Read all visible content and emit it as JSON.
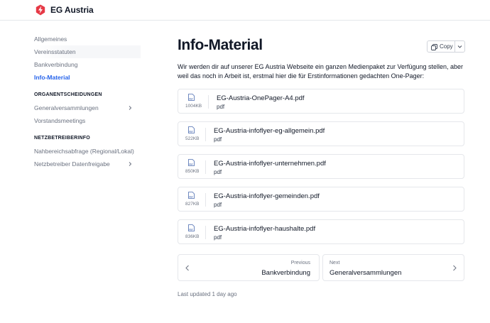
{
  "header": {
    "brand": "EG Austria",
    "logo_icon": "lightning-bolt-logo",
    "brand_color": "#e63946"
  },
  "sidebar": {
    "items": [
      {
        "label": "Allgemeines"
      },
      {
        "label": "Vereinsstatuten"
      },
      {
        "label": "Bankverbindung"
      },
      {
        "label": "Info-Material",
        "active": true
      }
    ],
    "section1": {
      "heading": "ORGANENTSCHEIDUNGEN",
      "items": [
        {
          "label": "Generalversammlungen",
          "has_children": true
        },
        {
          "label": "Vorstandsmeetings"
        }
      ]
    },
    "section2": {
      "heading": "NETZBETREIBERINFO",
      "items": [
        {
          "label": "Nahbereichsabfrage (Regional/Lokal)"
        },
        {
          "label": "Netzbetreiber Datenfreigabe",
          "has_children": true
        }
      ]
    },
    "active_color": "#2563eb"
  },
  "main": {
    "title": "Info-Material",
    "copy_label": "Copy",
    "intro": "Wir werden dir auf unserer EG Austria Webseite ein ganzen Medienpaket zur Verfügung stellen, aber weil das noch in Arbeit ist, erstmal hier die für Erstinformationen gedachten One-Pager:",
    "files": [
      {
        "name": "EG-Austria-OnePager-A4.pdf",
        "type": "pdf",
        "size": "1004KB",
        "icon_label": "PDF"
      },
      {
        "name": "EG-Austria-infoflyer-eg-allgemein.pdf",
        "type": "pdf",
        "size": "522KB",
        "icon_label": "PDF"
      },
      {
        "name": "EG-Austria-infoflyer-unternehmen.pdf",
        "type": "pdf",
        "size": "850KB",
        "icon_label": "PDF"
      },
      {
        "name": "EG-Austria-infoflyer-gemeinden.pdf",
        "type": "pdf",
        "size": "827KB",
        "icon_label": "PDF"
      },
      {
        "name": "EG-Austria-infoflyer-haushalte.pdf",
        "type": "pdf",
        "size": "836KB",
        "icon_label": "PDF"
      }
    ],
    "prev": {
      "small": "Previous",
      "label": "Bankverbindung"
    },
    "next": {
      "small": "Next",
      "label": "Generalversammlungen"
    },
    "last_updated": "Last updated 1 day ago"
  }
}
